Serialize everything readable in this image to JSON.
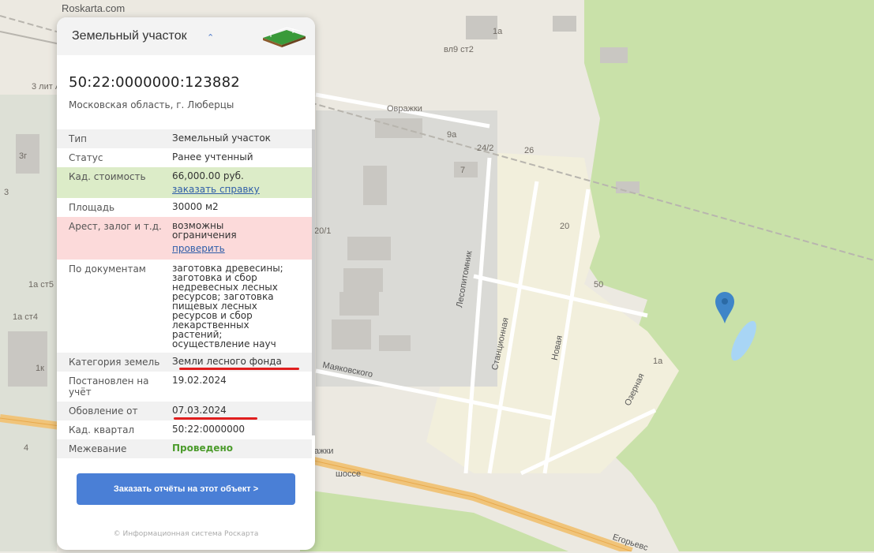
{
  "brand": "Roskarta.com",
  "map_labels": [
    "1а",
    "вл9 ст2",
    "3 лит А",
    "3г",
    "Овражки",
    "9а",
    "24/2",
    "26",
    "7",
    "3",
    "1а ст5",
    "1а ст4",
    "1к",
    "20/1",
    "20",
    "50",
    "1а",
    "4",
    "Лесопитомник",
    "Станционная",
    "Новая",
    "Озерная",
    "Маяковского",
    "ажки",
    "шоссе",
    "Егорьевс"
  ],
  "panel": {
    "title": "Земельный участок",
    "chevron": "⌃",
    "cadastral_number": "50:22:0000000:123882",
    "address": "Московская область, г. Люберцы",
    "rows": [
      {
        "key": "Тип",
        "value": "Земельный участок"
      },
      {
        "key": "Статус",
        "value": "Ранее учтенный"
      },
      {
        "key": "Кад. стоимость",
        "value": "66,000.00 руб.",
        "link": "заказать справку"
      },
      {
        "key": "Площадь",
        "value": "30000 м2"
      },
      {
        "key": "Арест, залог и т.д.",
        "value": "возможны ограничения",
        "link": "проверить"
      },
      {
        "key": "По документам",
        "value": "заготовка древесины; заготовка и сбор недревесных лесных ресурсов; заготовка пищевых лесных ресурсов и сбор лекарственных растений; осуществление науч"
      },
      {
        "key": "Категория земель",
        "value": "Земли лесного фонда"
      },
      {
        "key": "Постановлен на учёт",
        "value": "19.02.2024"
      },
      {
        "key": "Обовление от",
        "value": "07.03.2024"
      },
      {
        "key": "Кад. квартал",
        "value": "50:22:0000000"
      },
      {
        "key": "Межевание",
        "value": "Проведено"
      }
    ],
    "button": "Заказать отчёты на этот объект >",
    "footer": "© Информационная система Роскарта"
  },
  "colors": {
    "accent": "#4a7fd6",
    "green_row": "#dcecc8",
    "red_row": "#fcdada",
    "forest": "#c8e0a8",
    "marker": "#3f85c8"
  }
}
